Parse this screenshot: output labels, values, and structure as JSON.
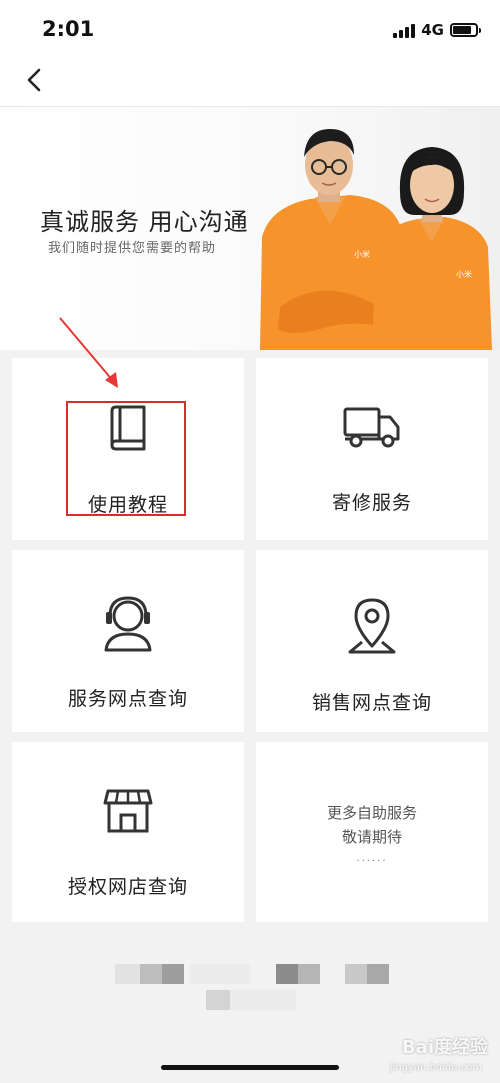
{
  "status_bar": {
    "time": "2:01",
    "network": "4G",
    "battery_level": 0.75
  },
  "nav": {
    "back_icon": "chevron-left-icon"
  },
  "banner": {
    "title": "真诚服务  用心沟通",
    "subtitle": "我们随时提供您需要的帮助",
    "shirt_logo_text": "小米"
  },
  "services": [
    {
      "label": "使用教程",
      "icon": "book-icon"
    },
    {
      "label": "寄修服务",
      "icon": "delivery-truck-icon"
    },
    {
      "label": "服务网点查询",
      "icon": "customer-service-headset-icon"
    },
    {
      "label": "销售网点查询",
      "icon": "location-pin-icon"
    },
    {
      "label": "授权网店查询",
      "icon": "storefront-icon"
    }
  ],
  "more_card": {
    "line1": "更多自助服务",
    "line2": "敬请期待",
    "dots": "......"
  },
  "annotation": {
    "highlight_color": "#d32f2f",
    "arrow_color": "#e53935"
  },
  "watermark": {
    "text": "Bai度经验",
    "sub": "jingyan.baidu.com"
  }
}
